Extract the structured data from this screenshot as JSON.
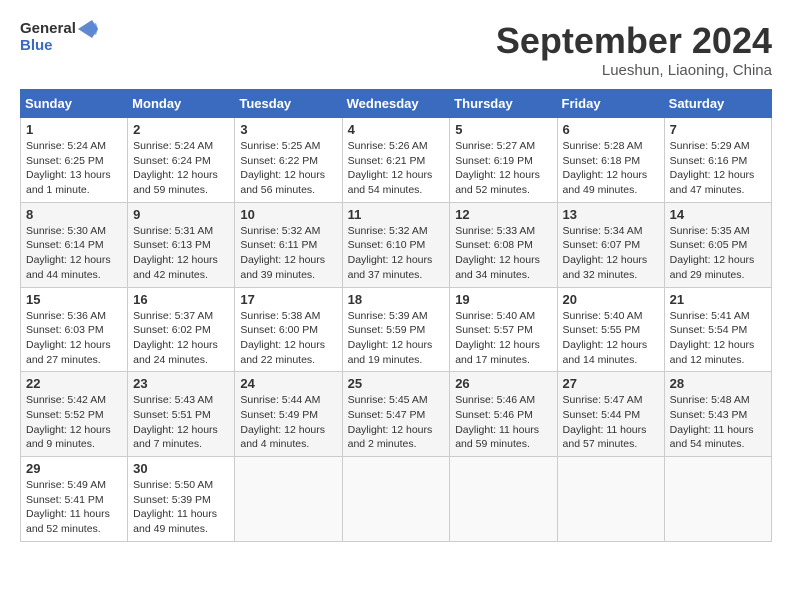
{
  "header": {
    "logo_line1": "General",
    "logo_line2": "Blue",
    "month": "September 2024",
    "location": "Lueshun, Liaoning, China"
  },
  "weekdays": [
    "Sunday",
    "Monday",
    "Tuesday",
    "Wednesday",
    "Thursday",
    "Friday",
    "Saturday"
  ],
  "weeks": [
    [
      {
        "day": "1",
        "info": "Sunrise: 5:24 AM\nSunset: 6:25 PM\nDaylight: 13 hours\nand 1 minute."
      },
      {
        "day": "2",
        "info": "Sunrise: 5:24 AM\nSunset: 6:24 PM\nDaylight: 12 hours\nand 59 minutes."
      },
      {
        "day": "3",
        "info": "Sunrise: 5:25 AM\nSunset: 6:22 PM\nDaylight: 12 hours\nand 56 minutes."
      },
      {
        "day": "4",
        "info": "Sunrise: 5:26 AM\nSunset: 6:21 PM\nDaylight: 12 hours\nand 54 minutes."
      },
      {
        "day": "5",
        "info": "Sunrise: 5:27 AM\nSunset: 6:19 PM\nDaylight: 12 hours\nand 52 minutes."
      },
      {
        "day": "6",
        "info": "Sunrise: 5:28 AM\nSunset: 6:18 PM\nDaylight: 12 hours\nand 49 minutes."
      },
      {
        "day": "7",
        "info": "Sunrise: 5:29 AM\nSunset: 6:16 PM\nDaylight: 12 hours\nand 47 minutes."
      }
    ],
    [
      {
        "day": "8",
        "info": "Sunrise: 5:30 AM\nSunset: 6:14 PM\nDaylight: 12 hours\nand 44 minutes."
      },
      {
        "day": "9",
        "info": "Sunrise: 5:31 AM\nSunset: 6:13 PM\nDaylight: 12 hours\nand 42 minutes."
      },
      {
        "day": "10",
        "info": "Sunrise: 5:32 AM\nSunset: 6:11 PM\nDaylight: 12 hours\nand 39 minutes."
      },
      {
        "day": "11",
        "info": "Sunrise: 5:32 AM\nSunset: 6:10 PM\nDaylight: 12 hours\nand 37 minutes."
      },
      {
        "day": "12",
        "info": "Sunrise: 5:33 AM\nSunset: 6:08 PM\nDaylight: 12 hours\nand 34 minutes."
      },
      {
        "day": "13",
        "info": "Sunrise: 5:34 AM\nSunset: 6:07 PM\nDaylight: 12 hours\nand 32 minutes."
      },
      {
        "day": "14",
        "info": "Sunrise: 5:35 AM\nSunset: 6:05 PM\nDaylight: 12 hours\nand 29 minutes."
      }
    ],
    [
      {
        "day": "15",
        "info": "Sunrise: 5:36 AM\nSunset: 6:03 PM\nDaylight: 12 hours\nand 27 minutes."
      },
      {
        "day": "16",
        "info": "Sunrise: 5:37 AM\nSunset: 6:02 PM\nDaylight: 12 hours\nand 24 minutes."
      },
      {
        "day": "17",
        "info": "Sunrise: 5:38 AM\nSunset: 6:00 PM\nDaylight: 12 hours\nand 22 minutes."
      },
      {
        "day": "18",
        "info": "Sunrise: 5:39 AM\nSunset: 5:59 PM\nDaylight: 12 hours\nand 19 minutes."
      },
      {
        "day": "19",
        "info": "Sunrise: 5:40 AM\nSunset: 5:57 PM\nDaylight: 12 hours\nand 17 minutes."
      },
      {
        "day": "20",
        "info": "Sunrise: 5:40 AM\nSunset: 5:55 PM\nDaylight: 12 hours\nand 14 minutes."
      },
      {
        "day": "21",
        "info": "Sunrise: 5:41 AM\nSunset: 5:54 PM\nDaylight: 12 hours\nand 12 minutes."
      }
    ],
    [
      {
        "day": "22",
        "info": "Sunrise: 5:42 AM\nSunset: 5:52 PM\nDaylight: 12 hours\nand 9 minutes."
      },
      {
        "day": "23",
        "info": "Sunrise: 5:43 AM\nSunset: 5:51 PM\nDaylight: 12 hours\nand 7 minutes."
      },
      {
        "day": "24",
        "info": "Sunrise: 5:44 AM\nSunset: 5:49 PM\nDaylight: 12 hours\nand 4 minutes."
      },
      {
        "day": "25",
        "info": "Sunrise: 5:45 AM\nSunset: 5:47 PM\nDaylight: 12 hours\nand 2 minutes."
      },
      {
        "day": "26",
        "info": "Sunrise: 5:46 AM\nSunset: 5:46 PM\nDaylight: 11 hours\nand 59 minutes."
      },
      {
        "day": "27",
        "info": "Sunrise: 5:47 AM\nSunset: 5:44 PM\nDaylight: 11 hours\nand 57 minutes."
      },
      {
        "day": "28",
        "info": "Sunrise: 5:48 AM\nSunset: 5:43 PM\nDaylight: 11 hours\nand 54 minutes."
      }
    ],
    [
      {
        "day": "29",
        "info": "Sunrise: 5:49 AM\nSunset: 5:41 PM\nDaylight: 11 hours\nand 52 minutes."
      },
      {
        "day": "30",
        "info": "Sunrise: 5:50 AM\nSunset: 5:39 PM\nDaylight: 11 hours\nand 49 minutes."
      },
      {
        "day": "",
        "info": ""
      },
      {
        "day": "",
        "info": ""
      },
      {
        "day": "",
        "info": ""
      },
      {
        "day": "",
        "info": ""
      },
      {
        "day": "",
        "info": ""
      }
    ]
  ]
}
